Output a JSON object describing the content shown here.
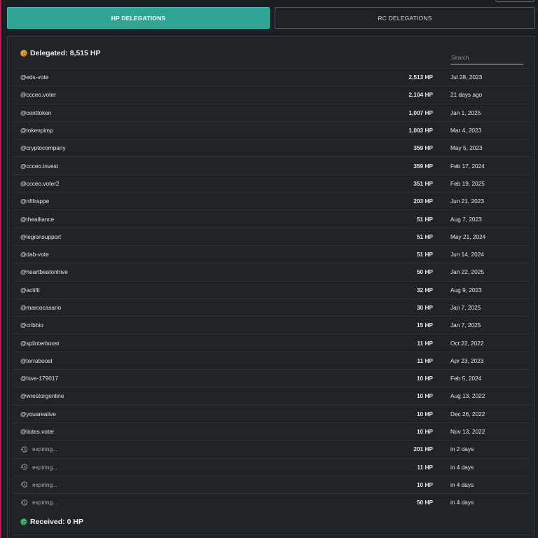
{
  "tabs": {
    "hp_label": "HP DELEGATIONS",
    "rc_label": "RC DELEGATIONS"
  },
  "delegated": {
    "label": "Delegated:",
    "value": "8,515 HP"
  },
  "search": {
    "placeholder": "Search"
  },
  "rows": [
    {
      "name": "@eds-vote",
      "amount": "2,513 HP",
      "date": "Jul 28, 2023"
    },
    {
      "name": "@ccceo.voter",
      "amount": "2,104 HP",
      "date": "21 days ago"
    },
    {
      "name": "@centtoken",
      "amount": "1,007 HP",
      "date": "Jan 1, 2025"
    },
    {
      "name": "@tokenpimp",
      "amount": "1,003 HP",
      "date": "Mar 4, 2023"
    },
    {
      "name": "@cryptocompany",
      "amount": "359 HP",
      "date": "May 5, 2023"
    },
    {
      "name": "@ccceo.invest",
      "amount": "359 HP",
      "date": "Feb 17, 2024"
    },
    {
      "name": "@ccceo.voter2",
      "amount": "351 HP",
      "date": "Feb 19, 2025"
    },
    {
      "name": "@nftfrappe",
      "amount": "203 HP",
      "date": "Jun 21, 2023"
    },
    {
      "name": "@thealliance",
      "amount": "51 HP",
      "date": "Aug 7, 2023"
    },
    {
      "name": "@legionsupport",
      "amount": "51 HP",
      "date": "May 21, 2024"
    },
    {
      "name": "@dab-vote",
      "amount": "51 HP",
      "date": "Jun 14, 2024"
    },
    {
      "name": "@heartbeatonhive",
      "amount": "50 HP",
      "date": "Jan 22, 2025"
    },
    {
      "name": "@actifit",
      "amount": "32 HP",
      "date": "Aug 9, 2023"
    },
    {
      "name": "@marcocasario",
      "amount": "30 HP",
      "date": "Jan 7, 2025"
    },
    {
      "name": "@cribbio",
      "amount": "15 HP",
      "date": "Jan 7, 2025"
    },
    {
      "name": "@splinterboost",
      "amount": "11 HP",
      "date": "Oct 22, 2022"
    },
    {
      "name": "@terraboost",
      "amount": "11 HP",
      "date": "Apr 23, 2023"
    },
    {
      "name": "@hive-179017",
      "amount": "10 HP",
      "date": "Feb 5, 2024"
    },
    {
      "name": "@wrestorgonline",
      "amount": "10 HP",
      "date": "Aug 13, 2022"
    },
    {
      "name": "@youarealive",
      "amount": "10 HP",
      "date": "Dec 26, 2022"
    },
    {
      "name": "@liotes.voter",
      "amount": "10 HP",
      "date": "Nov 13, 2022"
    }
  ],
  "expiring": [
    {
      "label": "expiring...",
      "amount": "201 HP",
      "date": "in 2 days",
      "icon": "history-icon"
    },
    {
      "label": "expiring...",
      "amount": "11 HP",
      "date": "in 4 days",
      "icon": "history-icon"
    },
    {
      "label": "expiring...",
      "amount": "10 HP",
      "date": "in 4 days",
      "icon": "history-icon"
    },
    {
      "label": "expiring...",
      "amount": "50 HP",
      "date": "in 4 days",
      "icon": "history-icon"
    }
  ],
  "received": {
    "label": "Received:",
    "value": "0 HP"
  },
  "colors": {
    "accent": "#2fa596",
    "delegated_coin": "#e9a43a",
    "received_coin": "#44b36b",
    "left_edge": "#b5214a"
  }
}
